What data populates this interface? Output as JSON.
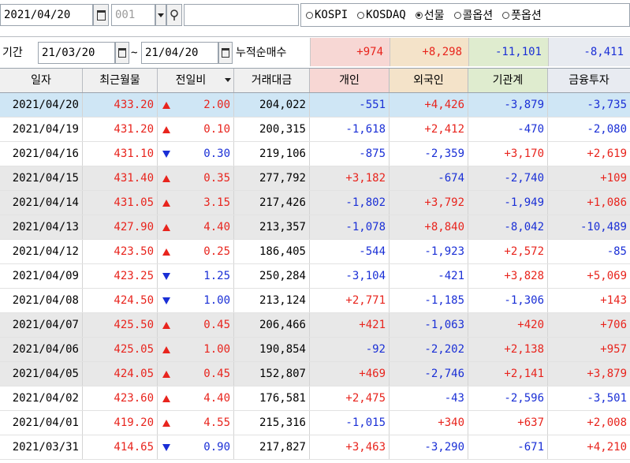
{
  "toolbar": {
    "date": "2021/04/20",
    "code": "001",
    "search_value": "",
    "markets": [
      {
        "label": "KOSPI",
        "selected": false
      },
      {
        "label": "KOSDAQ",
        "selected": false
      },
      {
        "label": "선물",
        "selected": true
      },
      {
        "label": "콜옵션",
        "selected": false
      },
      {
        "label": "풋옵션",
        "selected": false
      }
    ]
  },
  "period": {
    "label": "기간",
    "from": "21/03/20",
    "separator": "~",
    "to": "21/04/20",
    "cumulative_label": "누적순매수",
    "sums": [
      "+974",
      "+8,298",
      "-11,101",
      "-8,411"
    ]
  },
  "colors": {
    "sum_individual_bg": "#f7d7d4",
    "sum_foreign_bg": "#f4e3c9",
    "sum_institution_bg": "#dfeccf",
    "sum_finance_bg": "#e8ebf1",
    "hdr_individual_bg": "#f7d7d4",
    "hdr_foreign_bg": "#f4e3c9",
    "hdr_institution_bg": "#dfeccf",
    "hdr_finance_bg": "#e8ebf1",
    "selected_row_bg": "#cfe6f5",
    "gray_row_bg": "#e8e8e8",
    "up": "#e8241d",
    "down": "#1a2fd6"
  },
  "table": {
    "headers": [
      "일자",
      "최근월물",
      "전일비",
      "거래대금",
      "개인",
      "외국인",
      "기관계",
      "금융투자"
    ],
    "rows": [
      {
        "date": "2021/04/20",
        "price": "433.20",
        "dir": "up",
        "change": "2.00",
        "volume": "204,022",
        "individual": "-551",
        "foreign": "+4,426",
        "institution": "-3,879",
        "finance": "-3,735",
        "shade": "selected"
      },
      {
        "date": "2021/04/19",
        "price": "431.20",
        "dir": "up",
        "change": "0.10",
        "volume": "200,315",
        "individual": "-1,618",
        "foreign": "+2,412",
        "institution": "-470",
        "finance": "-2,080",
        "shade": "white"
      },
      {
        "date": "2021/04/16",
        "price": "431.10",
        "dir": "down",
        "change": "0.30",
        "volume": "219,106",
        "individual": "-875",
        "foreign": "-2,359",
        "institution": "+3,170",
        "finance": "+2,619",
        "shade": "white"
      },
      {
        "date": "2021/04/15",
        "price": "431.40",
        "dir": "up",
        "change": "0.35",
        "volume": "277,792",
        "individual": "+3,182",
        "foreign": "-674",
        "institution": "-2,740",
        "finance": "+109",
        "shade": "gray"
      },
      {
        "date": "2021/04/14",
        "price": "431.05",
        "dir": "up",
        "change": "3.15",
        "volume": "217,426",
        "individual": "-1,802",
        "foreign": "+3,792",
        "institution": "-1,949",
        "finance": "+1,086",
        "shade": "gray"
      },
      {
        "date": "2021/04/13",
        "price": "427.90",
        "dir": "up",
        "change": "4.40",
        "volume": "213,357",
        "individual": "-1,078",
        "foreign": "+8,840",
        "institution": "-8,042",
        "finance": "-10,489",
        "shade": "gray"
      },
      {
        "date": "2021/04/12",
        "price": "423.50",
        "dir": "up",
        "change": "0.25",
        "volume": "186,405",
        "individual": "-544",
        "foreign": "-1,923",
        "institution": "+2,572",
        "finance": "-85",
        "shade": "white"
      },
      {
        "date": "2021/04/09",
        "price": "423.25",
        "dir": "down",
        "change": "1.25",
        "volume": "250,284",
        "individual": "-3,104",
        "foreign": "-421",
        "institution": "+3,828",
        "finance": "+5,069",
        "shade": "white"
      },
      {
        "date": "2021/04/08",
        "price": "424.50",
        "dir": "down",
        "change": "1.00",
        "volume": "213,124",
        "individual": "+2,771",
        "foreign": "-1,185",
        "institution": "-1,306",
        "finance": "+143",
        "shade": "white"
      },
      {
        "date": "2021/04/07",
        "price": "425.50",
        "dir": "up",
        "change": "0.45",
        "volume": "206,466",
        "individual": "+421",
        "foreign": "-1,063",
        "institution": "+420",
        "finance": "+706",
        "shade": "gray"
      },
      {
        "date": "2021/04/06",
        "price": "425.05",
        "dir": "up",
        "change": "1.00",
        "volume": "190,854",
        "individual": "-92",
        "foreign": "-2,202",
        "institution": "+2,138",
        "finance": "+957",
        "shade": "gray"
      },
      {
        "date": "2021/04/05",
        "price": "424.05",
        "dir": "up",
        "change": "0.45",
        "volume": "152,807",
        "individual": "+469",
        "foreign": "-2,746",
        "institution": "+2,141",
        "finance": "+3,879",
        "shade": "gray"
      },
      {
        "date": "2021/04/02",
        "price": "423.60",
        "dir": "up",
        "change": "4.40",
        "volume": "176,581",
        "individual": "+2,475",
        "foreign": "-43",
        "institution": "-2,596",
        "finance": "-3,501",
        "shade": "white"
      },
      {
        "date": "2021/04/01",
        "price": "419.20",
        "dir": "up",
        "change": "4.55",
        "volume": "215,316",
        "individual": "-1,015",
        "foreign": "+340",
        "institution": "+637",
        "finance": "+2,008",
        "shade": "white"
      },
      {
        "date": "2021/03/31",
        "price": "414.65",
        "dir": "down",
        "change": "0.90",
        "volume": "217,827",
        "individual": "+3,463",
        "foreign": "-3,290",
        "institution": "-671",
        "finance": "+4,210",
        "shade": "white"
      }
    ]
  }
}
